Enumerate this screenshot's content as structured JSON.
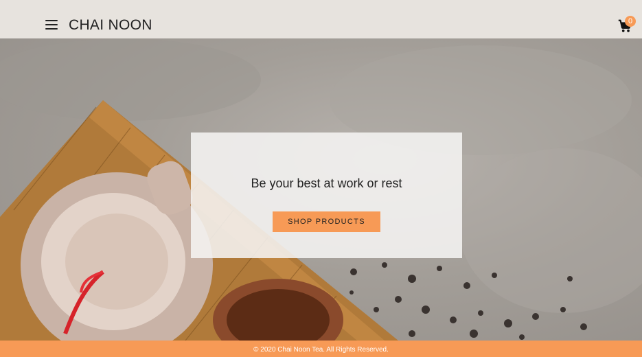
{
  "header": {
    "logo_text": "CHAI NOON",
    "cart_count": "0",
    "menu_icon": "hamburger-menu-icon",
    "cart_icon": "shopping-cart-icon"
  },
  "hero": {
    "tagline": "Be your best at work or rest",
    "cta_label": "SHOP PRODUCTS"
  },
  "footer": {
    "copyright": "© 2020 Chai Noon Tea. All Rights Reserved."
  },
  "colors": {
    "accent": "#f79a56",
    "header_bg": "#e7e3de",
    "text": "#222222"
  }
}
